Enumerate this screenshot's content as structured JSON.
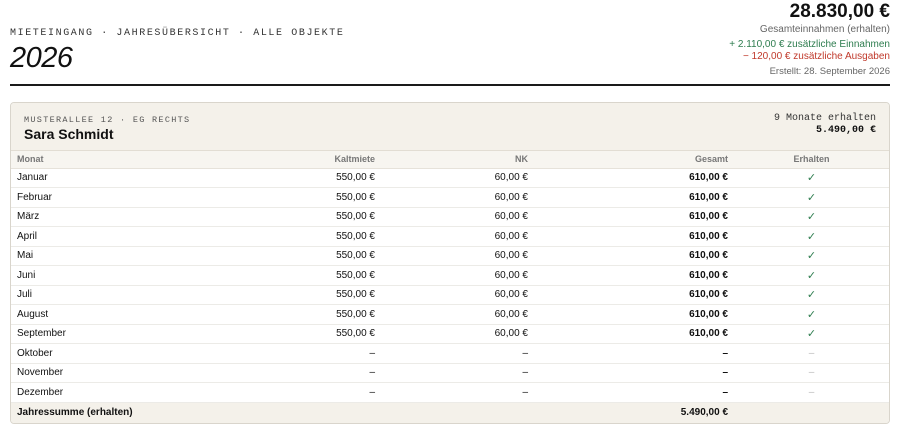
{
  "header": {
    "eyebrow": "MIETEINGANG · JAHRESÜBERSICHT · ALLE OBJEKTE",
    "year": "2026"
  },
  "summary": {
    "total": "28.830,00 €",
    "total_label": "Gesamteinnahmen (erhalten)",
    "extra_income": "+ 2.110,00 € zusätzliche Einnahmen",
    "extra_expense": "− 120,00 € zusätzliche Ausgaben",
    "created": "Erstellt: 28. September 2026"
  },
  "card": {
    "address": "MUSTERALLEE 12 · EG RECHTS",
    "tenant": "Sara Schmidt",
    "months_received": "9 Monate erhalten",
    "sum": "5.490,00 €"
  },
  "table": {
    "columns": [
      "Monat",
      "Kaltmiete",
      "NK",
      "Gesamt",
      "Erhalten"
    ],
    "rows": [
      {
        "month": "Januar",
        "kalt": "550,00 €",
        "nk": "60,00 €",
        "gesamt": "610,00 €",
        "erhalten": "✓"
      },
      {
        "month": "Februar",
        "kalt": "550,00 €",
        "nk": "60,00 €",
        "gesamt": "610,00 €",
        "erhalten": "✓"
      },
      {
        "month": "März",
        "kalt": "550,00 €",
        "nk": "60,00 €",
        "gesamt": "610,00 €",
        "erhalten": "✓"
      },
      {
        "month": "April",
        "kalt": "550,00 €",
        "nk": "60,00 €",
        "gesamt": "610,00 €",
        "erhalten": "✓"
      },
      {
        "month": "Mai",
        "kalt": "550,00 €",
        "nk": "60,00 €",
        "gesamt": "610,00 €",
        "erhalten": "✓"
      },
      {
        "month": "Juni",
        "kalt": "550,00 €",
        "nk": "60,00 €",
        "gesamt": "610,00 €",
        "erhalten": "✓"
      },
      {
        "month": "Juli",
        "kalt": "550,00 €",
        "nk": "60,00 €",
        "gesamt": "610,00 €",
        "erhalten": "✓"
      },
      {
        "month": "August",
        "kalt": "550,00 €",
        "nk": "60,00 €",
        "gesamt": "610,00 €",
        "erhalten": "✓"
      },
      {
        "month": "September",
        "kalt": "550,00 €",
        "nk": "60,00 €",
        "gesamt": "610,00 €",
        "erhalten": "✓"
      },
      {
        "month": "Oktober",
        "kalt": "–",
        "nk": "–",
        "gesamt": "–",
        "erhalten": "–"
      },
      {
        "month": "November",
        "kalt": "–",
        "nk": "–",
        "gesamt": "–",
        "erhalten": "–"
      },
      {
        "month": "Dezember",
        "kalt": "–",
        "nk": "–",
        "gesamt": "–",
        "erhalten": "–"
      }
    ],
    "footer": {
      "label": "Jahressumme (erhalten)",
      "gesamt": "5.490,00 €"
    }
  },
  "colors": {
    "income": "#2e7d4f",
    "expense": "#c0392b",
    "card_header_bg": "#f4f1ea"
  }
}
